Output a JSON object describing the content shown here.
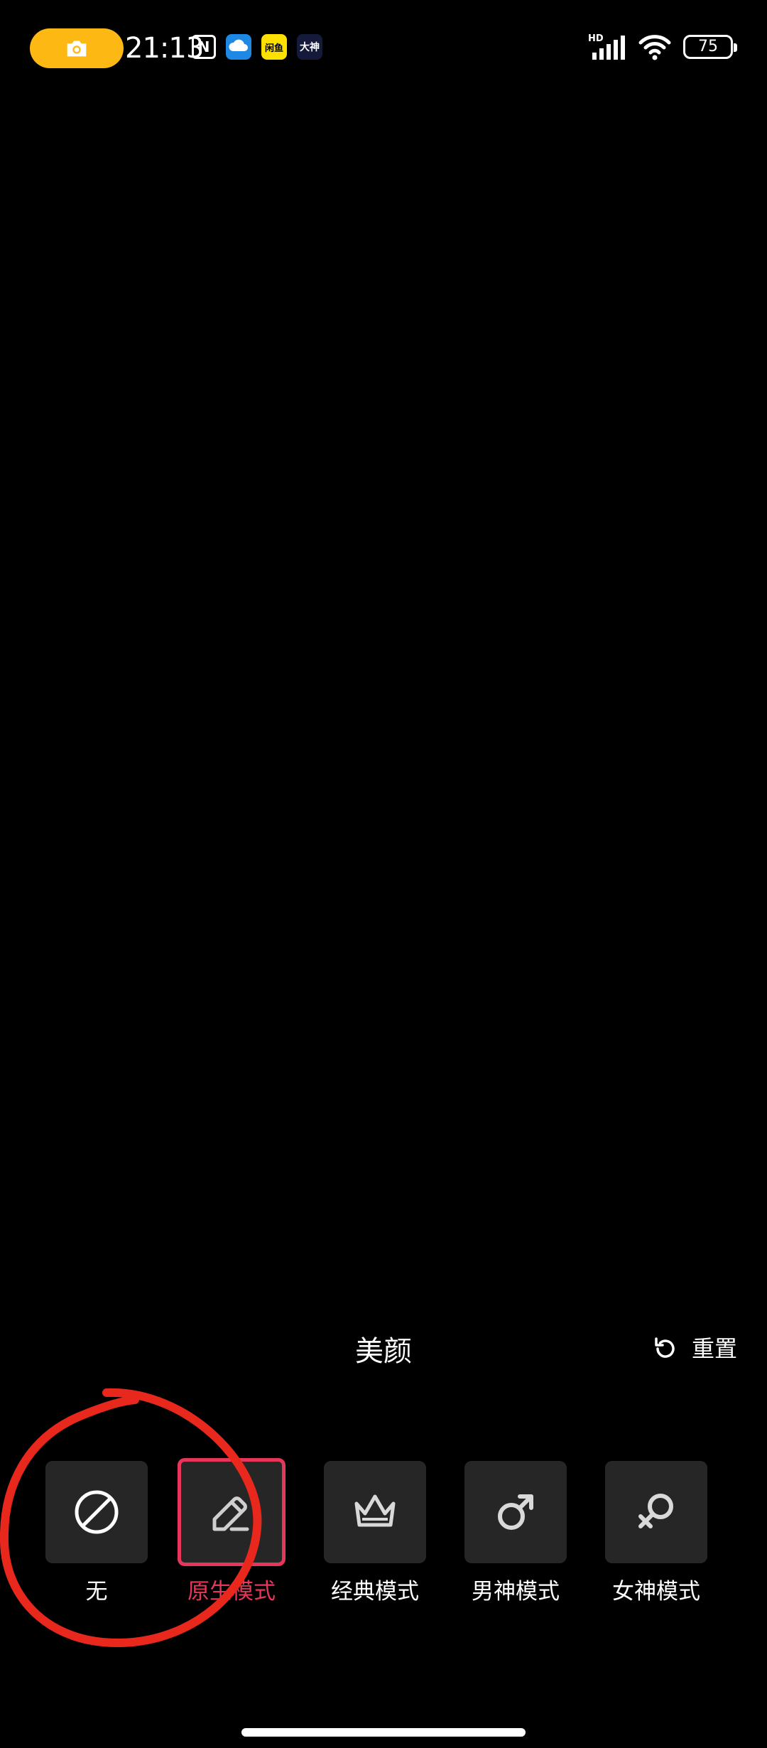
{
  "status_bar": {
    "time": "21:13",
    "battery_level": "75",
    "network_badge": "HD",
    "notif_yellow": "闲鱼",
    "notif_dashen": "大神"
  },
  "panel": {
    "title": "美颜",
    "reset_label": "重置"
  },
  "modes": [
    {
      "label": "无",
      "icon": "none-icon",
      "selected": false
    },
    {
      "label": "原生模式",
      "icon": "edit-pencil-icon",
      "selected": true
    },
    {
      "label": "经典模式",
      "icon": "crown-icon",
      "selected": false
    },
    {
      "label": "男神模式",
      "icon": "male-icon",
      "selected": false
    },
    {
      "label": "女神模式",
      "icon": "female-icon",
      "selected": false
    }
  ],
  "colors": {
    "accent": "#E8365A",
    "recording_pill": "#FDB814",
    "tile_bg": "#262626",
    "annotation": "#E8271D"
  }
}
